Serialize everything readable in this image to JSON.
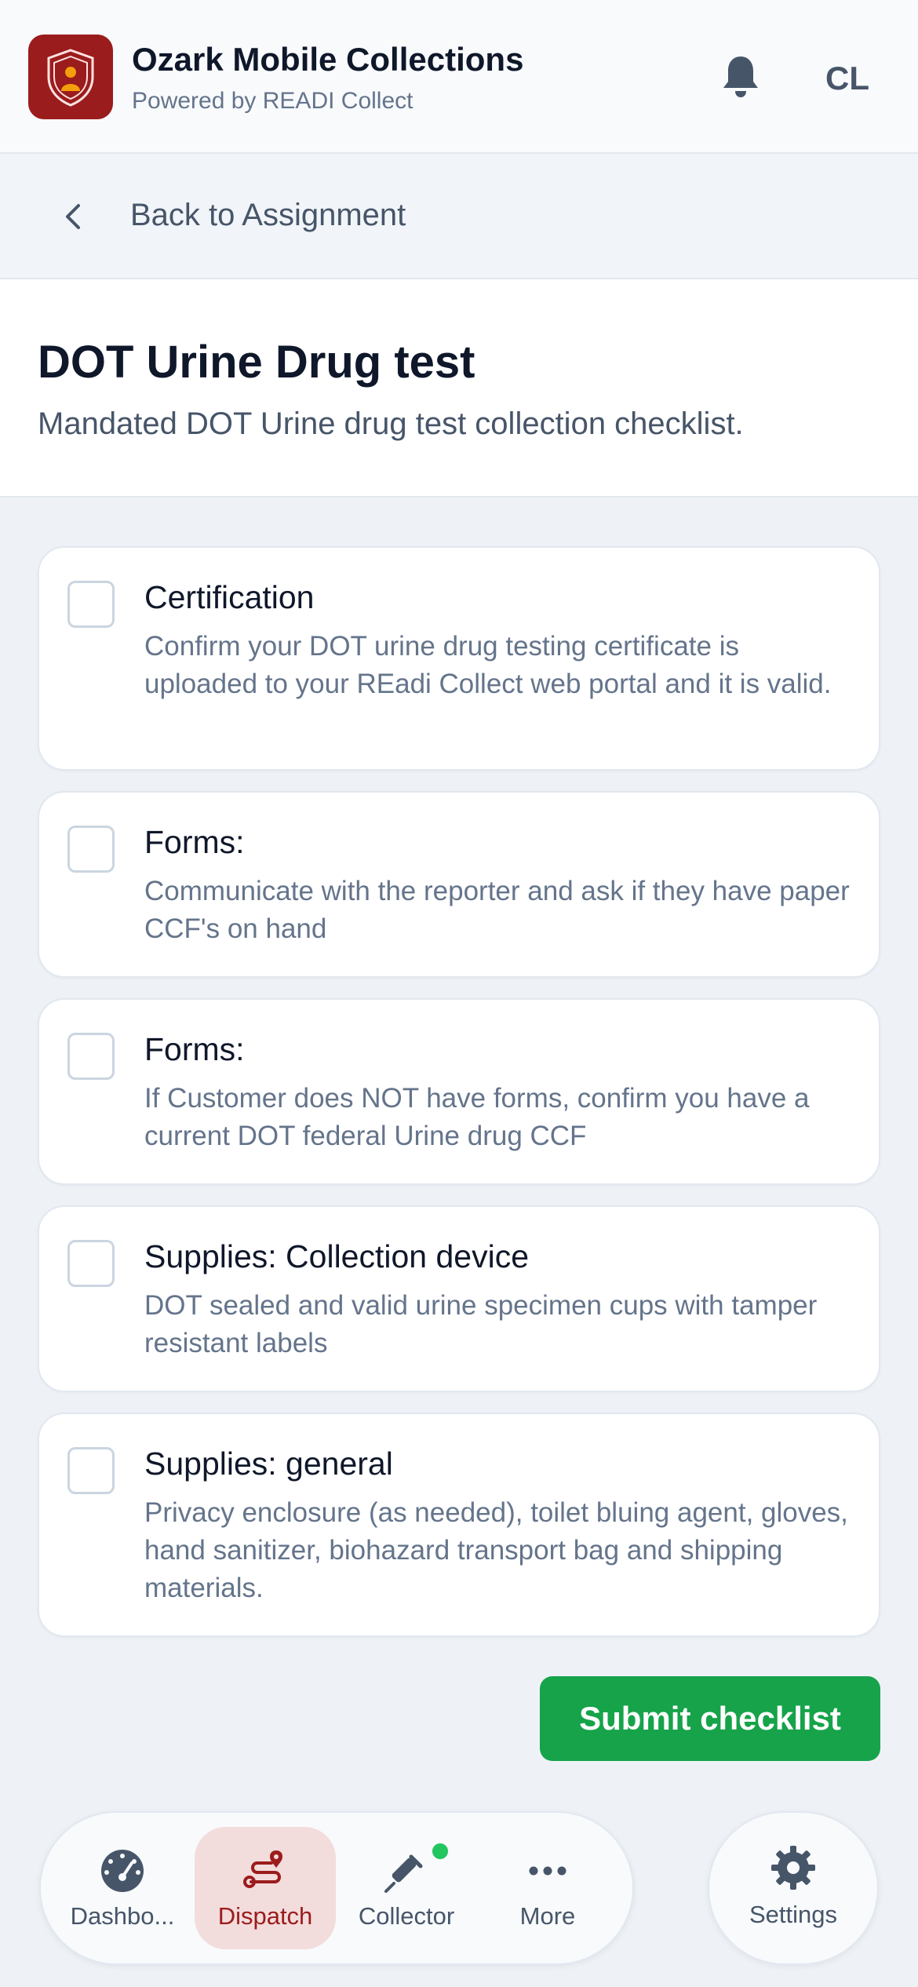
{
  "header": {
    "app_title": "Ozark Mobile Collections",
    "subtitle": "Powered by READI Collect",
    "avatar_initials": "CL",
    "brand_color": "#9b1c1c",
    "icons": {
      "logo": "shield-person-logo",
      "notifications": "bell-icon"
    }
  },
  "back": {
    "label": "Back to Assignment",
    "icon": "chevron-left-icon"
  },
  "page": {
    "title": "DOT Urine Drug test",
    "description": "Mandated DOT Urine drug test collection checklist."
  },
  "checklist": [
    {
      "title": "Certification",
      "description": "Confirm your DOT urine drug testing certificate is uploaded to your REadi Collect web portal and it is valid.",
      "checked": false
    },
    {
      "title": "Forms:",
      "description": "Communicate with the reporter and ask if they have paper CCF's on hand",
      "checked": false
    },
    {
      "title": "Forms:",
      "description": "If Customer does NOT have forms, confirm you have a current DOT federal Urine drug CCF",
      "checked": false
    },
    {
      "title": "Supplies: Collection device",
      "description": "DOT sealed and valid urine specimen cups with tamper resistant labels",
      "checked": false
    },
    {
      "title": "Supplies: general",
      "description": "Privacy enclosure (as needed), toilet bluing agent, gloves, hand sanitizer, biohazard transport bag and shipping materials.",
      "checked": false
    }
  ],
  "submit": {
    "label": "Submit checklist",
    "color": "#16a34a"
  },
  "nav": {
    "items": [
      {
        "label": "Dashbo...",
        "icon": "gauge-icon",
        "active": false
      },
      {
        "label": "Dispatch",
        "icon": "route-icon",
        "active": true
      },
      {
        "label": "Collector",
        "icon": "syringe-icon",
        "active": false,
        "status_dot": "#22c55e"
      },
      {
        "label": "More",
        "icon": "more-horizontal-icon",
        "active": false
      }
    ],
    "settings": {
      "label": "Settings",
      "icon": "gear-icon"
    }
  }
}
